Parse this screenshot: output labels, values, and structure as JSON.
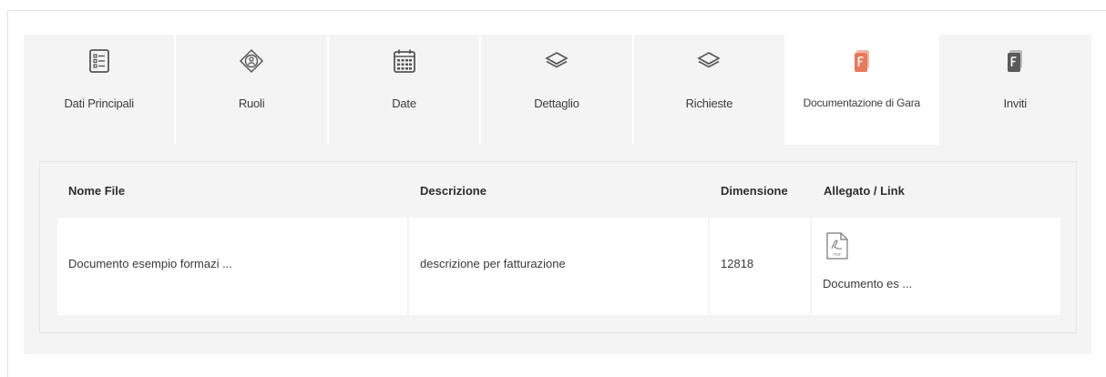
{
  "tabs": [
    {
      "label": "Dati Principali",
      "icon": "list-doc-icon"
    },
    {
      "label": "Ruoli",
      "icon": "user-role-icon"
    },
    {
      "label": "Date",
      "icon": "calendar-icon"
    },
    {
      "label": "Dettaglio",
      "icon": "layers-icon"
    },
    {
      "label": "Richieste",
      "icon": "layers-icon"
    },
    {
      "label": "Documentazione di Gara",
      "icon": "document-icon",
      "active": true
    },
    {
      "label": "Inviti",
      "icon": "document-icon"
    }
  ],
  "colors": {
    "accent": "#e8795a",
    "tab_bg": "#f4f4f4",
    "icon": "#555555"
  },
  "table": {
    "headers": [
      "Nome File",
      "Descrizione",
      "Dimensione",
      "Allegato / Link"
    ],
    "rows": [
      {
        "name": "Documento esempio formazi ...",
        "description": "descrizione per fatturazione",
        "size": "12818",
        "attachment_icon": "pdf-icon",
        "attachment_name": "Documento es ..."
      }
    ]
  }
}
